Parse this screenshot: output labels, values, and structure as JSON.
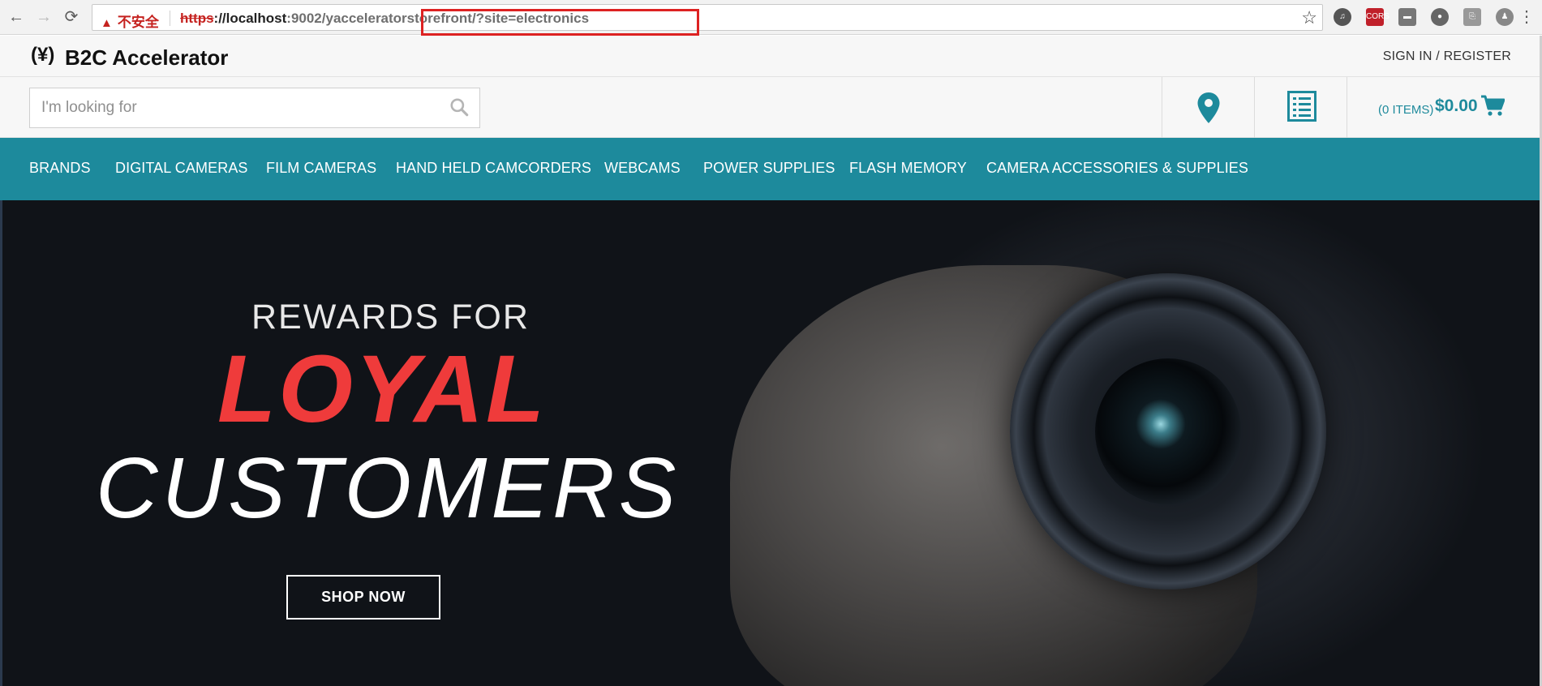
{
  "browser": {
    "security_icon": "warning-triangle",
    "security_label": "不安全",
    "url_scheme": "https",
    "url_host": "://localhost",
    "url_port": ":9002",
    "url_path": "/yacceleratorstorefront/?site=electronics",
    "highlight_color": "#dd2222"
  },
  "header": {
    "logo_mark": "(¥)",
    "logo_text": "B2C Accelerator",
    "signin_label": "SIGN IN / REGISTER"
  },
  "search": {
    "placeholder": "I'm looking for"
  },
  "minicart": {
    "items_label": "(0 ITEMS)",
    "total": "$0.00"
  },
  "categories": [
    "BRANDS",
    "DIGITAL CAMERAS",
    "FILM CAMERAS",
    "HAND HELD CAMCORDERS",
    "WEBCAMS",
    "POWER SUPPLIES",
    "FLASH MEMORY",
    "CAMERA ACCESSORIES & SUPPLIES"
  ],
  "hero": {
    "kicker": "REWARDS FOR",
    "headline": "LOYAL",
    "subheadline": "CUSTOMERS",
    "cta": "SHOP NOW"
  },
  "colors": {
    "brand_teal": "#1d8a9c",
    "accent_red": "#ef3b3b"
  }
}
